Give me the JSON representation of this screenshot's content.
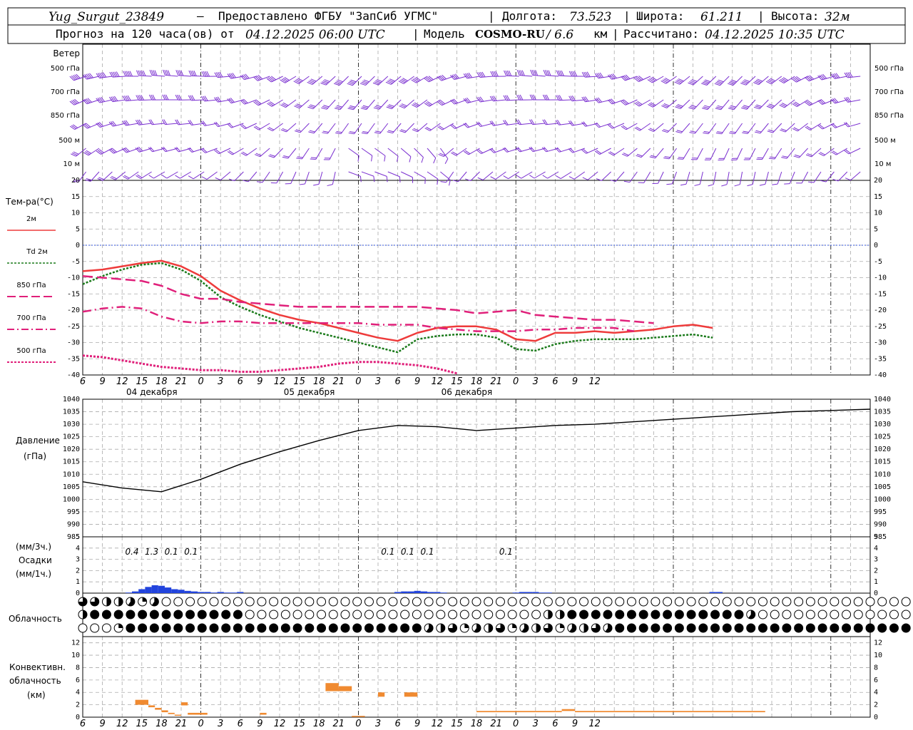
{
  "header": {
    "station": "Yug_Surgut_23849",
    "dash": "—",
    "provider": "Предоставлено ФГБУ \"ЗапСиб УГМС\"",
    "lon_label": "Долгота:",
    "lon": "73.523",
    "lat_label": "Широта:",
    "lat": "61.211",
    "alt_label": "Высота:",
    "alt": "32м",
    "forecast_pre": "Прогноз на 120 часа(ов)  от",
    "forecast_time": "04.12.2025 06:00 UTC",
    "model_label": "Модель",
    "model": "COSMO-RU",
    "model_res": "/ 6.6",
    "model_res_unit": "км",
    "calc_label": "Рассчитано:",
    "calc_time": "04.12.2025 10:35 UTC"
  },
  "time_axis": {
    "hours": [
      "6",
      "9",
      "12",
      "15",
      "18",
      "21",
      "0",
      "3",
      "6",
      "9",
      "12",
      "15",
      "18",
      "21",
      "0",
      "3",
      "6",
      "9",
      "12",
      "15",
      "18",
      "21",
      "0",
      "3",
      "6",
      "9",
      "12"
    ],
    "dates": [
      "04 декабря",
      "05 декабря",
      "06 декабря"
    ]
  },
  "wind": {
    "title": "Ветер",
    "levels": [
      "500 гПа",
      "700 гПа",
      "850 гПа",
      "500  м",
      "10   м"
    ]
  },
  "temp": {
    "title": "Тем-ра(°C)",
    "legend": [
      {
        "label": "2м",
        "color": "#ee3b3b"
      },
      {
        "label": "Td 2м",
        "color": "#1a7a1a"
      },
      {
        "label": "850 гПа",
        "color": "#e0207a"
      },
      {
        "label": "700 гПа",
        "color": "#e0207a"
      },
      {
        "label": "500 гПа",
        "color": "#e0207a"
      }
    ],
    "yticks": [
      "20",
      "15",
      "10",
      "5",
      "0",
      "-5",
      "-10",
      "-15",
      "-20",
      "-25",
      "-30",
      "-35",
      "-40"
    ]
  },
  "pressure": {
    "title": "Давление",
    "unit": "(гПа)",
    "yticks": [
      "1040",
      "1035",
      "1030",
      "1025",
      "1020",
      "1015",
      "1010",
      "1005",
      "1000",
      "995",
      "990",
      "985"
    ]
  },
  "precip": {
    "unit3": "(мм/3ч.)",
    "title": "Осадки",
    "unit1": "(мм/1ч.)",
    "yticks": [
      "5",
      "4",
      "3",
      "2",
      "1",
      "0"
    ],
    "labels": [
      {
        "h": 9,
        "text": "0.4"
      },
      {
        "h": 12,
        "text": "1.3"
      },
      {
        "h": 15,
        "text": "0.1"
      },
      {
        "h": 18,
        "text": "0.1"
      },
      {
        "h": 48,
        "text": "0.1"
      },
      {
        "h": 51,
        "text": "0.1"
      },
      {
        "h": 54,
        "text": "0.1"
      },
      {
        "h": 66,
        "text": "0.1"
      }
    ]
  },
  "clouds": {
    "title": "Облачность"
  },
  "conv": {
    "title1": "Конвективн.",
    "title2": "облачность",
    "unit": "(км)",
    "yticks": [
      "12",
      "10",
      "8",
      "6",
      "4",
      "2",
      "0"
    ]
  },
  "colors": {
    "wind": "#7a2fd0",
    "t2m": "#ee3b3b",
    "td": "#1a7a1a",
    "upper": "#e0207a",
    "precip": "#2244dd",
    "conv": "#f08a30",
    "zero": "#3355dd"
  },
  "chart_data": [
    {
      "type": "line",
      "name": "temperature",
      "x_hours": [
        0,
        3,
        6,
        9,
        12,
        15,
        18,
        21,
        24,
        27,
        30,
        33,
        36,
        39,
        42,
        45,
        48,
        51,
        54,
        57,
        60,
        63,
        66,
        69,
        72,
        75,
        78,
        81,
        84,
        87,
        90,
        93,
        96,
        99,
        102,
        105,
        108,
        111,
        114,
        117,
        120
      ],
      "ylim": [
        -40,
        20
      ],
      "series": [
        {
          "name": "2м",
          "values": [
            -8,
            -7.5,
            -6.5,
            -5.5,
            -4.8,
            -6.5,
            -9.5,
            -14,
            -17,
            -19.5,
            -21.5,
            -23,
            -24,
            -25.5,
            -27,
            -28.5,
            -29.5,
            -27,
            -25.5,
            -25,
            -25,
            -26,
            -29,
            -29.5,
            -27,
            -27,
            -26.5,
            -27,
            -26.5,
            -26,
            -25,
            -24.5,
            -25.5
          ]
        },
        {
          "name": "Td 2м",
          "values": [
            -12,
            -9.5,
            -7.5,
            -6,
            -5.5,
            -7.5,
            -11,
            -16,
            -19,
            -21.5,
            -23.5,
            -25.5,
            -27,
            -28.5,
            -30,
            -31.5,
            -33,
            -29,
            -28,
            -27.5,
            -27.5,
            -28.5,
            -32,
            -32.5,
            -30.5,
            -29.5,
            -29,
            -29,
            -29,
            -28.5,
            -28,
            -27.5,
            -28.5
          ]
        },
        {
          "name": "850 гПа",
          "values": [
            -9.5,
            -10,
            -10.5,
            -11,
            -12.5,
            -15,
            -16.5,
            -16.5,
            -17.5,
            -18,
            -18.5,
            -19,
            -19,
            -19,
            -19,
            -19,
            -19,
            -19,
            -19.5,
            -20,
            -21,
            -20.5,
            -20,
            -21.5,
            -22,
            -22.5,
            -23,
            -23,
            -23.5,
            -24
          ]
        },
        {
          "name": "700 гПа",
          "values": [
            -20.5,
            -19.5,
            -19,
            -19.5,
            -22,
            -23.5,
            -24,
            -23.5,
            -23.5,
            -24,
            -24,
            -24,
            -24,
            -24,
            -24,
            -24.5,
            -24.5,
            -24.5,
            -25.5,
            -26,
            -26.5,
            -26.5,
            -26.5,
            -26,
            -26,
            -25.5,
            -25.5,
            -25.5,
            -26.5
          ]
        },
        {
          "name": "500 гПа",
          "values": [
            -34,
            -34.5,
            -35.5,
            -36.5,
            -37.5,
            -38,
            -38.5,
            -38.5,
            -39,
            -39,
            -38.5,
            -38,
            -37.5,
            -36.5,
            -36,
            -36,
            -36.5,
            -37,
            -38,
            -39.5
          ]
        }
      ]
    },
    {
      "type": "line",
      "name": "pressure",
      "x_hours": [
        0,
        6,
        12,
        18,
        24,
        30,
        36,
        42,
        48,
        54,
        60,
        66,
        72,
        78,
        84,
        90,
        96,
        102,
        108,
        114,
        120
      ],
      "ylim": [
        985,
        1040
      ],
      "series": [
        {
          "name": "Давление",
          "values": [
            1007,
            1004.5,
            1003,
            1008,
            1014,
            1019,
            1023.5,
            1027.5,
            1029.5,
            1029,
            1027.5,
            1028.5,
            1029.5,
            1030,
            1031,
            1032,
            1033,
            1034,
            1035,
            1035.5,
            1036
          ]
        }
      ]
    },
    {
      "type": "bar",
      "name": "precipitation_mm_per_hour",
      "x_hours": [
        7,
        8,
        9,
        10,
        11,
        12,
        13,
        14,
        15,
        16,
        17,
        18,
        19,
        20,
        21,
        22,
        23,
        24,
        48,
        49,
        50,
        51,
        52,
        53,
        54,
        55,
        66,
        67,
        68,
        69,
        70,
        71,
        96,
        97
      ],
      "ylim": [
        0,
        5
      ],
      "values": [
        0.05,
        0.15,
        0.35,
        0.55,
        0.7,
        0.65,
        0.5,
        0.35,
        0.3,
        0.2,
        0.15,
        0.1,
        0.1,
        0.05,
        0.1,
        0.05,
        0.05,
        0.1,
        0.1,
        0.15,
        0.15,
        0.2,
        0.15,
        0.1,
        0.1,
        0.05,
        0.05,
        0.1,
        0.1,
        0.1,
        0.05,
        0.05,
        0.1,
        0.1
      ]
    },
    {
      "type": "bar",
      "name": "convective_cloud_km",
      "ylim": [
        0,
        13
      ],
      "segments": [
        {
          "h0": 8,
          "h1": 10,
          "bottom": 2,
          "top": 2.8
        },
        {
          "h0": 10,
          "h1": 11,
          "bottom": 1.6,
          "top": 1.9
        },
        {
          "h0": 11,
          "h1": 12,
          "bottom": 1.2,
          "top": 1.5
        },
        {
          "h0": 12,
          "h1": 13,
          "bottom": 0.8,
          "top": 1.1
        },
        {
          "h0": 13,
          "h1": 14,
          "bottom": 0.5,
          "top": 0.7
        },
        {
          "h0": 14,
          "h1": 15,
          "bottom": 0.3,
          "top": 0.4
        },
        {
          "h0": 15,
          "h1": 16,
          "bottom": 1.9,
          "top": 2.4
        },
        {
          "h0": 16,
          "h1": 19,
          "bottom": 0.4,
          "top": 0.7
        },
        {
          "h0": 27,
          "h1": 28,
          "bottom": 0.4,
          "top": 0.7
        },
        {
          "h0": 37,
          "h1": 39,
          "bottom": 4.2,
          "top": 5.5
        },
        {
          "h0": 39,
          "h1": 41,
          "bottom": 4.2,
          "top": 5
        },
        {
          "h0": 41,
          "h1": 43,
          "bottom": 0.1,
          "top": 0.2
        },
        {
          "h0": 45,
          "h1": 46,
          "bottom": 3.3,
          "top": 4
        },
        {
          "h0": 49,
          "h1": 51,
          "bottom": 3.3,
          "top": 4
        },
        {
          "h0": 60,
          "h1": 73,
          "bottom": 0.8,
          "top": 1
        },
        {
          "h0": 73,
          "h1": 75,
          "bottom": 1,
          "top": 1.3
        },
        {
          "h0": 75,
          "h1": 104,
          "bottom": 0.8,
          "top": 1
        }
      ]
    },
    {
      "type": "table",
      "name": "cloud_cover_octas",
      "x_hours": "0..120 step 1 (shown every ~1h)",
      "rows": [
        {
          "level": "upper",
          "states": "mixed: partly at 6-10h, clear afterwards"
        },
        {
          "level": "middle",
          "states": "overcast 7-17h, clear 18-41h, overcast 42-56h, clear after"
        },
        {
          "level": "lower",
          "states": "clear 6-9h, overcast 10-34h, partly 35-46h, overcast 47-120h"
        }
      ]
    }
  ]
}
